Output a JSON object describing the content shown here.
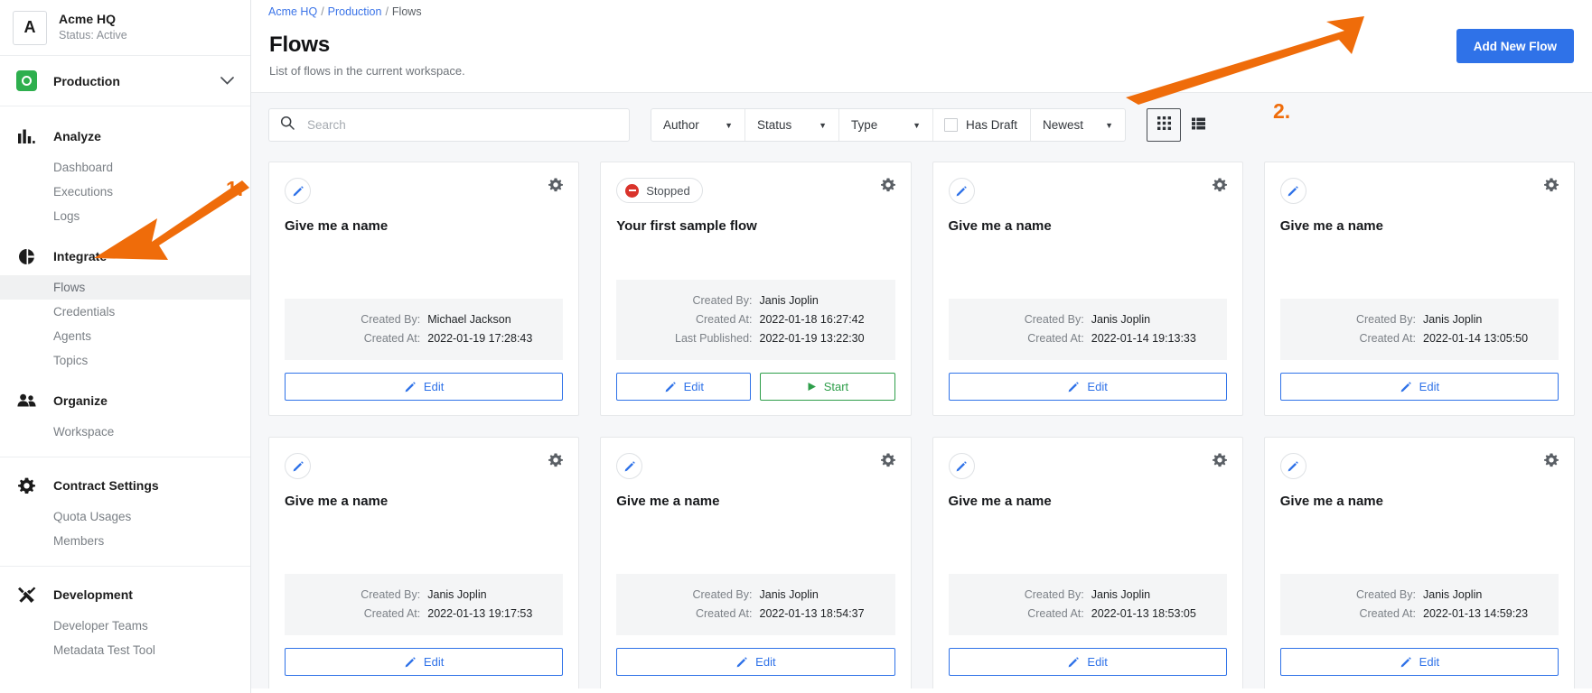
{
  "sidebar": {
    "org": {
      "avatar_letter": "A",
      "name": "Acme HQ",
      "status": "Status: Active"
    },
    "environment": {
      "label": "Production",
      "icon": "target-circle-icon",
      "chevron": "chevron-down-icon"
    },
    "groups": [
      {
        "label": "Analyze",
        "icon": "bar-chart-icon",
        "items": [
          {
            "label": "Dashboard",
            "active": false
          },
          {
            "label": "Executions",
            "active": false
          },
          {
            "label": "Logs",
            "active": false
          }
        ]
      },
      {
        "label": "Integrate",
        "icon": "pie-chart-icon",
        "items": [
          {
            "label": "Flows",
            "active": true
          },
          {
            "label": "Credentials",
            "active": false
          },
          {
            "label": "Agents",
            "active": false
          },
          {
            "label": "Topics",
            "active": false
          }
        ]
      },
      {
        "label": "Organize",
        "icon": "people-icon",
        "items": [
          {
            "label": "Workspace",
            "active": false
          }
        ]
      },
      {
        "label": "Contract Settings",
        "icon": "gear-icon",
        "items": [
          {
            "label": "Quota Usages",
            "active": false
          },
          {
            "label": "Members",
            "active": false
          }
        ]
      },
      {
        "label": "Development",
        "icon": "tools-icon",
        "items": [
          {
            "label": "Developer Teams",
            "active": false
          },
          {
            "label": "Metadata Test Tool",
            "active": false
          }
        ]
      }
    ]
  },
  "header": {
    "breadcrumb": [
      {
        "label": "Acme HQ",
        "link": true
      },
      {
        "label": "Production",
        "link": true
      },
      {
        "label": "Flows",
        "link": false
      }
    ],
    "separator": "/",
    "title": "Flows",
    "subtitle": "List of flows in the current workspace.",
    "add_button": "Add New Flow"
  },
  "toolbar": {
    "search_placeholder": "Search",
    "search_value": "",
    "search_icon": "search-icon",
    "filters": [
      {
        "label": "Author",
        "type": "select"
      },
      {
        "label": "Status",
        "type": "select"
      },
      {
        "label": "Type",
        "type": "select"
      }
    ],
    "has_draft": {
      "label": "Has Draft",
      "checked": false
    },
    "sort": {
      "label": "Newest",
      "type": "select"
    },
    "view_modes": [
      {
        "name": "grid",
        "icon": "grid-view-icon",
        "selected": true
      },
      {
        "name": "list",
        "icon": "list-view-icon",
        "selected": false
      }
    ]
  },
  "labels": {
    "created_by": "Created By:",
    "created_at": "Created At:",
    "last_published": "Last Published:",
    "edit": "Edit",
    "start": "Start"
  },
  "cards": [
    {
      "name": "Give me a name",
      "badge": null,
      "has_pencil": true,
      "created_by": "Michael Jackson",
      "created_at": "2022-01-19 17:28:43",
      "last_published": null,
      "actions": [
        "edit"
      ]
    },
    {
      "name": "Your first sample flow",
      "badge": {
        "label": "Stopped",
        "color": "#d9332b"
      },
      "has_pencil": false,
      "created_by": "Janis Joplin",
      "created_at": "2022-01-18 16:27:42",
      "last_published": "2022-01-19 13:22:30",
      "actions": [
        "edit",
        "start"
      ]
    },
    {
      "name": "Give me a name",
      "badge": null,
      "has_pencil": true,
      "created_by": "Janis Joplin",
      "created_at": "2022-01-14 19:13:33",
      "last_published": null,
      "actions": [
        "edit"
      ]
    },
    {
      "name": "Give me a name",
      "badge": null,
      "has_pencil": true,
      "created_by": "Janis Joplin",
      "created_at": "2022-01-14 13:05:50",
      "last_published": null,
      "actions": [
        "edit"
      ]
    },
    {
      "name": "Give me a name",
      "badge": null,
      "has_pencil": true,
      "created_by": "Janis Joplin",
      "created_at": "2022-01-13 19:17:53",
      "last_published": null,
      "actions": [
        "edit"
      ]
    },
    {
      "name": "Give me a name",
      "badge": null,
      "has_pencil": true,
      "created_by": "Janis Joplin",
      "created_at": "2022-01-13 18:54:37",
      "last_published": null,
      "actions": [
        "edit"
      ]
    },
    {
      "name": "Give me a name",
      "badge": null,
      "has_pencil": true,
      "created_by": "Janis Joplin",
      "created_at": "2022-01-13 18:53:05",
      "last_published": null,
      "actions": [
        "edit"
      ]
    },
    {
      "name": "Give me a name",
      "badge": null,
      "has_pencil": true,
      "created_by": "Janis Joplin",
      "created_at": "2022-01-13 14:59:23",
      "last_published": null,
      "actions": [
        "edit"
      ]
    }
  ],
  "annotations": [
    {
      "label": "1.",
      "target": "sidebar-item-flows"
    },
    {
      "label": "2.",
      "target": "add-new-flow-button"
    }
  ],
  "colors": {
    "accent_blue": "#2f72e8",
    "link_blue": "#3b74e8",
    "green": "#2e9e4a",
    "red": "#d9332b",
    "annotation_orange": "#ef6c0a",
    "page_bg": "#f6f7f9"
  }
}
